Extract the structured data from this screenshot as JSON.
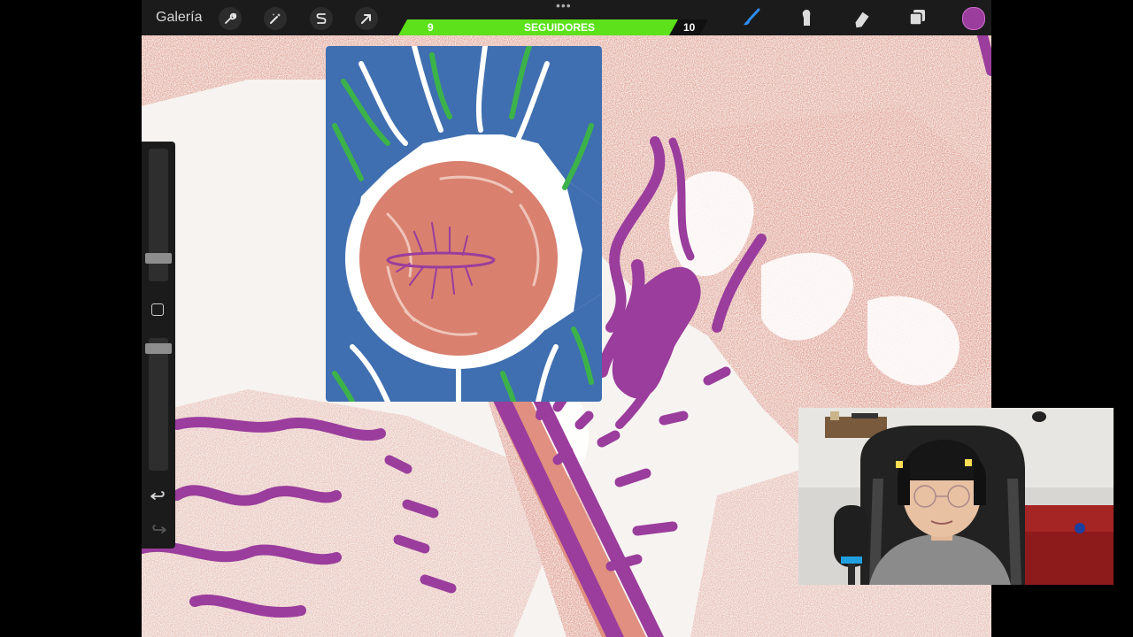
{
  "toolbar": {
    "gallery_label": "Galería",
    "left_tools": [
      {
        "name": "actions",
        "icon": "wrench-icon"
      },
      {
        "name": "adjustments",
        "icon": "magic-wand-icon"
      },
      {
        "name": "selection",
        "icon": "selection-s-icon"
      },
      {
        "name": "transform",
        "icon": "arrow-cursor-icon"
      }
    ],
    "right_tools": [
      {
        "name": "brush",
        "icon": "brush-icon",
        "active": true
      },
      {
        "name": "smudge",
        "icon": "smudge-icon"
      },
      {
        "name": "eraser",
        "icon": "eraser-icon"
      },
      {
        "name": "layers",
        "icon": "layers-icon"
      }
    ],
    "current_color": "#9a3d9c",
    "more_icon": "ellipsis-icon"
  },
  "followers_goal": {
    "current_label": "9",
    "title": "SEGUIDORES",
    "target_label": "10",
    "progress": 0.9,
    "bar_color": "#5ce11a"
  },
  "sidebar": {
    "brush_size": 0.7,
    "brush_opacity": 1.0,
    "modify_icon": "square-icon",
    "undo_icon": "undo-icon",
    "redo_icon": "redo-icon"
  },
  "canvas_colors": {
    "salmon": "#d9806f",
    "purple": "#9a3d9c",
    "blue": "#3f6fb0",
    "green": "#3cb34a",
    "paper": "#f7f3f1"
  },
  "reference_window": {
    "description_icon": "reference-image"
  },
  "webcam": {
    "icon": "webcam-overlay"
  }
}
